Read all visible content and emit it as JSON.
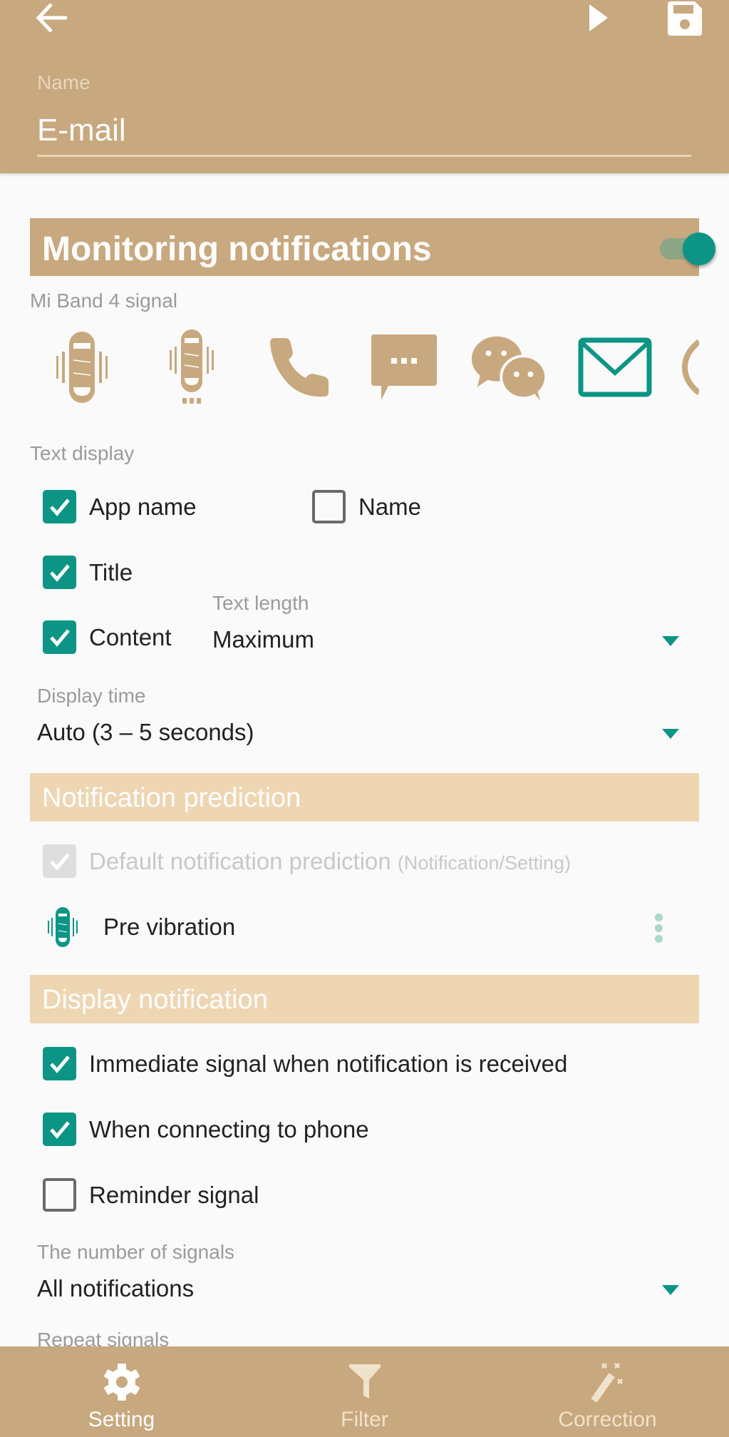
{
  "header": {
    "back_icon": "arrow-left-icon",
    "play_icon": "play-icon",
    "save_icon": "floppy-save-icon",
    "name_label": "Name",
    "name_value": "E-mail"
  },
  "monitoring": {
    "title": "Monitoring notifications",
    "enabled": true,
    "signal_label": "Mi Band 4 signal",
    "signal_icons": [
      {
        "name": "band-vibrate-long-icon",
        "selected": false
      },
      {
        "name": "band-vibrate-short-icon",
        "selected": false
      },
      {
        "name": "phone-call-icon",
        "selected": false
      },
      {
        "name": "sms-message-icon",
        "selected": false
      },
      {
        "name": "wechat-chat-icon",
        "selected": false
      },
      {
        "name": "email-envelope-icon",
        "selected": true
      },
      {
        "name": "partial-icon",
        "selected": false
      }
    ]
  },
  "text_display": {
    "label": "Text display",
    "options": [
      {
        "label": "App name",
        "checked": true
      },
      {
        "label": "Name",
        "checked": false
      },
      {
        "label": "Title",
        "checked": true
      },
      {
        "label": "Content",
        "checked": true
      }
    ],
    "text_length_label": "Text length",
    "text_length_value": "Maximum",
    "display_time_label": "Display time",
    "display_time_value": "Auto (3 – 5 seconds)"
  },
  "prediction": {
    "title": "Notification prediction",
    "default_label": "Default notification prediction",
    "default_hint": "(Notification/Setting)",
    "default_checked": true,
    "default_disabled": true,
    "pre_vibration_label": "Pre vibration"
  },
  "display_notification": {
    "title": "Display notification",
    "options": [
      {
        "label": "Immediate signal when notification is received",
        "checked": true
      },
      {
        "label": "When connecting to phone",
        "checked": true
      },
      {
        "label": "Reminder signal",
        "checked": false
      }
    ],
    "number_label": "The number of signals",
    "number_value": "All notifications",
    "repeat_label": "Repeat signals"
  },
  "bottom_nav": {
    "items": [
      {
        "label": "Setting",
        "icon": "gear-icon",
        "active": true
      },
      {
        "label": "Filter",
        "icon": "filter-funnel-icon",
        "active": false
      },
      {
        "label": "Correction",
        "icon": "magic-wand-icon",
        "active": false
      }
    ]
  },
  "colors": {
    "brand": "#c8a87e",
    "section_light": "#eed6b3",
    "accent": "#0c9584"
  }
}
